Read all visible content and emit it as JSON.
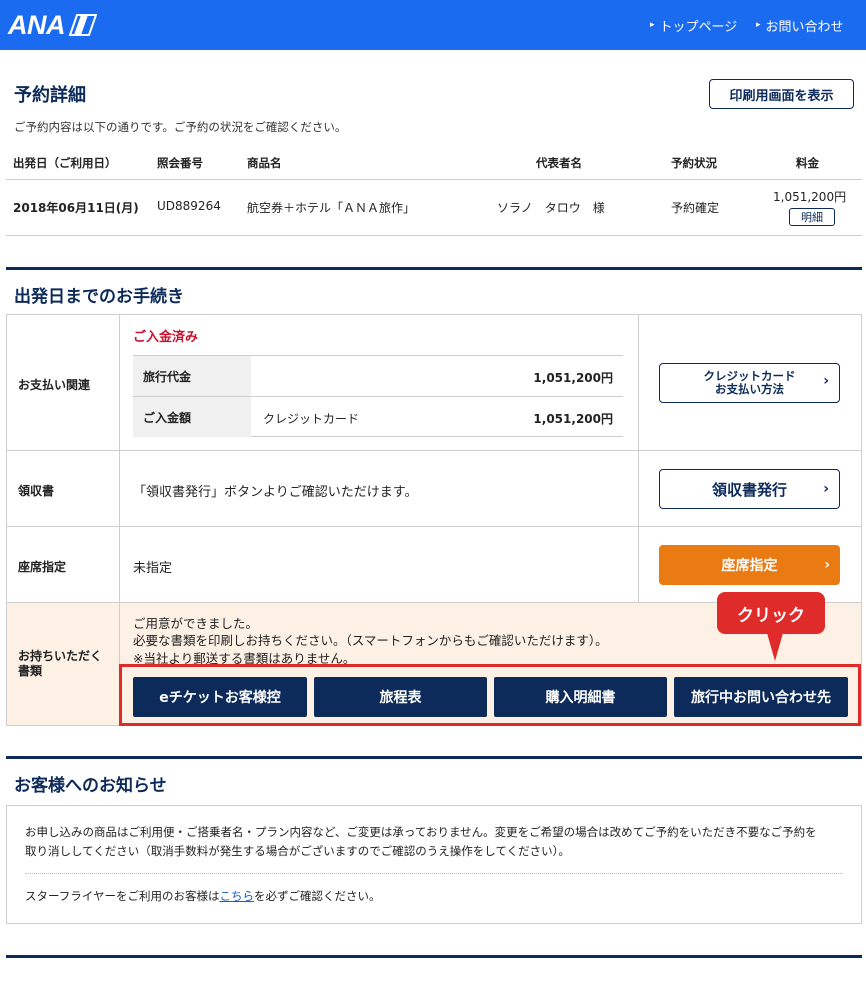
{
  "header": {
    "logo_text": "ANA",
    "nav": [
      "トップページ",
      "お問い合わせ"
    ],
    "bg_color": "#1a6bf0"
  },
  "reservation": {
    "title": "予約詳細",
    "print_button": "印刷用画面を表示",
    "subtitle": "ご予約内容は以下の通りです。ご予約の状況をご確認ください。",
    "columns": [
      "出発日（ご利用日）",
      "照会番号",
      "商品名",
      "代表者名",
      "予約状況",
      "料金"
    ],
    "row": {
      "date": "2018年06月11日(月)",
      "ref": "UD889264",
      "product": "航空券＋ホテル「ＡＮＡ旅作」",
      "rep": "ソラノ　タロウ　様",
      "status": "予約確定",
      "fee": "1,051,200円",
      "detail_button": "明細"
    }
  },
  "procedures": {
    "title": "出発日までのお手続き",
    "payment": {
      "label": "お支払い関連",
      "status": "ご入金済み",
      "rows": [
        {
          "label": "旅行代金",
          "method": "",
          "amount": "1,051,200円"
        },
        {
          "label": "ご入金額",
          "method": "クレジットカード",
          "amount": "1,051,200円"
        }
      ],
      "button_line1": "クレジットカード",
      "button_line2": "お支払い方法"
    },
    "receipt": {
      "label": "領収書",
      "text": "「領収書発行」ボタンよりご確認いただけます。",
      "button": "領収書発行"
    },
    "seat": {
      "label": "座席指定",
      "text": "未指定",
      "button": "座席指定"
    },
    "documents": {
      "label_line1": "お持ちいただく",
      "label_line2": "書類",
      "messages": [
        "ご用意ができました。",
        "必要な書類を印刷しお持ちください。（スマートフォンからもご確認いただけます）。",
        "※当社より郵送する書類はありません。"
      ],
      "buttons": [
        "eチケットお客様控",
        "旅程表",
        "購入明細書",
        "旅行中お問い合わせ先"
      ],
      "callout": "クリック"
    }
  },
  "notices": {
    "title": "お客様へのお知らせ",
    "line1": "お申し込みの商品はご利用便・ご搭乗者名・プラン内容など、ご変更は承っておりません。変更をご希望の場合は改めてご予約をいただき不要なご予約を",
    "line2": "取り消ししてください（取消手数料が発生する場合がございますのでご確認のうえ操作をしてください）。",
    "star_prefix": "スターフライヤーをご利用のお客様は",
    "star_link": "こちら",
    "star_suffix": "を必ずご確認ください。"
  },
  "colors": {
    "navy": "#0c2a5a",
    "orange": "#ea7a12",
    "red": "#e02b2b",
    "paid_red": "#c8102e"
  }
}
